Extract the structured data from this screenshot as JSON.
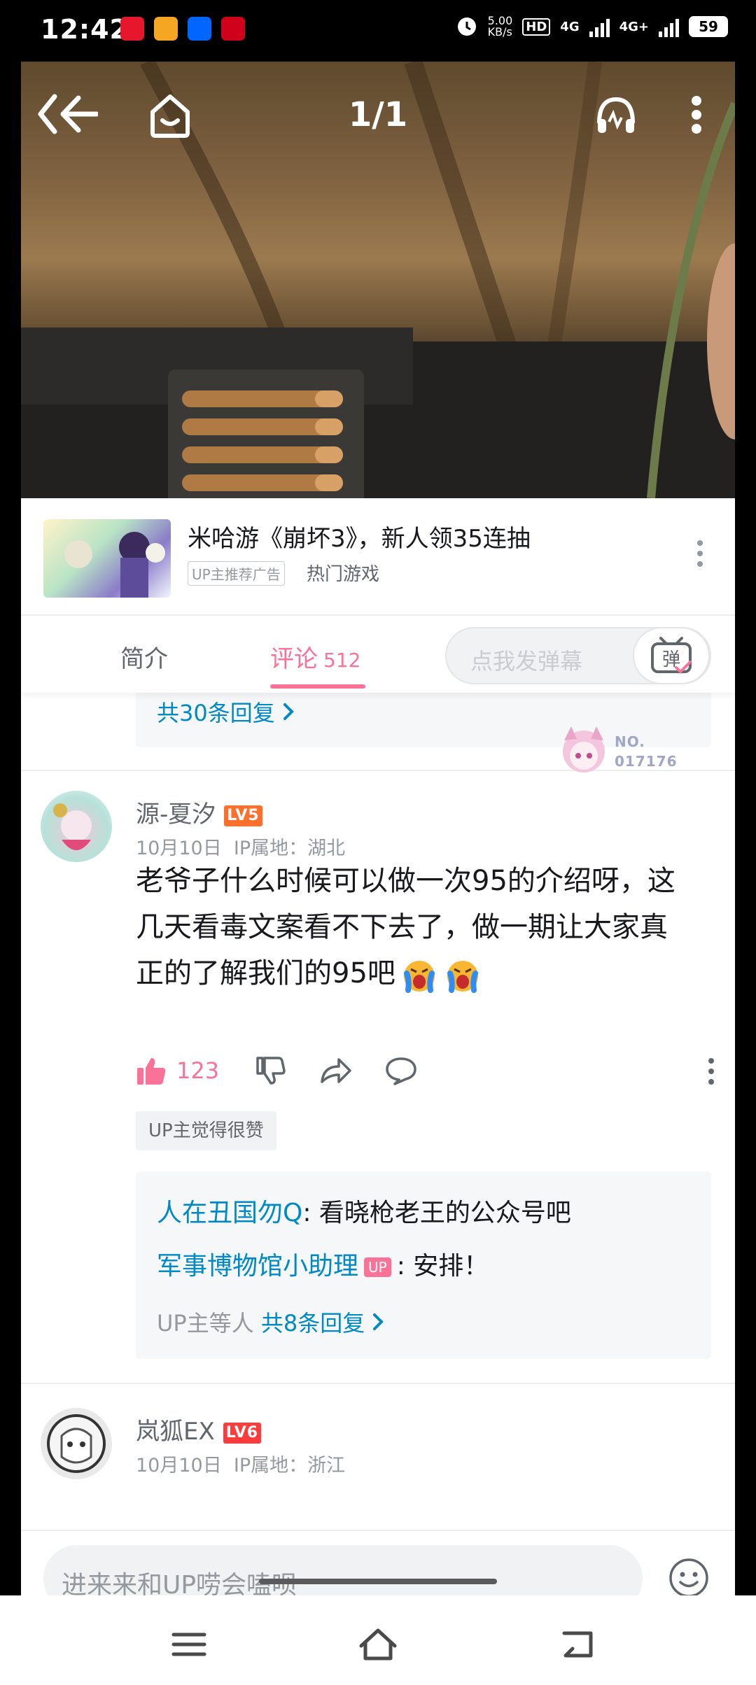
{
  "status_bar": {
    "time": "12:42",
    "speed": "5.00\nKB/s",
    "hd": "HD",
    "net1": "4G",
    "net2": "4G+",
    "battery": "59"
  },
  "video": {
    "counter": "1/1"
  },
  "ad": {
    "title": "米哈游《崩坏3》，新人领35连抽",
    "tag": "UP主推荐广告",
    "category": "热门游戏"
  },
  "tabs": {
    "intro": "简介",
    "comments": "评论",
    "comments_count": "512",
    "danmaku_placeholder": "点我发弹幕",
    "danmaku_toggle": "弹"
  },
  "comments": {
    "prev_replies_link": "共30条回复",
    "items": [
      {
        "user": "源-夏汐",
        "level": "LV5",
        "date": "10月10日",
        "ip_label": "IP属地：",
        "ip_location": "湖北",
        "fan_no_label": "NO.",
        "fan_no": "017176",
        "text_line1": "老爷子什么时候可以做一次95的介绍呀，这",
        "text_line2": "几天看毒文案看不下去了，做一期让大家真",
        "text_line3": "正的了解我们的95吧",
        "likes": "123",
        "up_liked": "UP主觉得很赞",
        "replies": [
          {
            "user": "人在丑国勿Q",
            "text": ": 看晓枪老王的公众号吧"
          },
          {
            "user": "军事博物馆小助理",
            "badge": "UP",
            "text": ": 安排！"
          }
        ],
        "reply_summary_prefix": "UP主等人",
        "reply_summary_link": "共8条回复"
      },
      {
        "user": "岚狐EX",
        "level": "LV6",
        "date": "10月10日",
        "ip_label": "IP属地：",
        "ip_location": "浙江"
      }
    ]
  },
  "input": {
    "placeholder": "进来来和UP唠会嗑呗"
  },
  "colors": {
    "accent": "#fb7299",
    "link": "#008ac5",
    "level_badge": "#ff6f2c"
  }
}
